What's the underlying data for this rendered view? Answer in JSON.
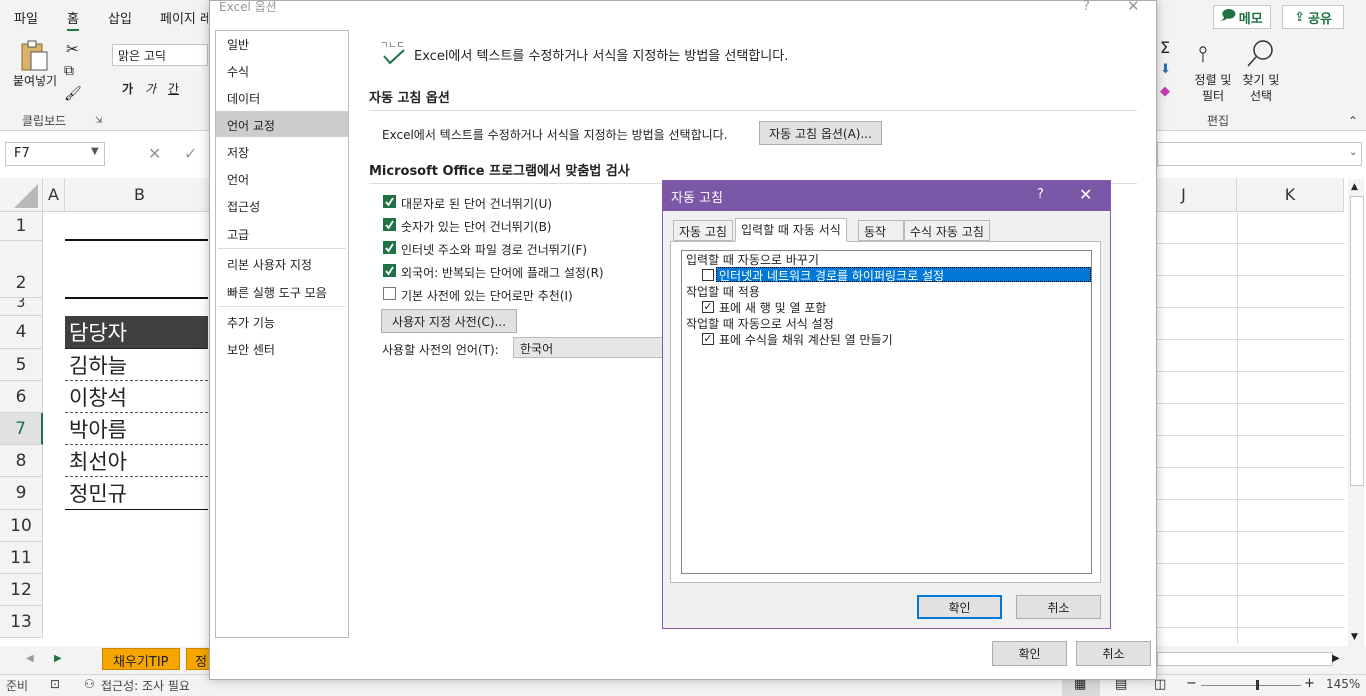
{
  "ribbon": {
    "tabs": [
      "파일",
      "홈",
      "삽입",
      "페이지 레"
    ],
    "active_tab": "홈",
    "memo_label": "메모",
    "share_label": "공유",
    "paste_label": "붙여넣기",
    "clipboard_label": "클립보드",
    "font_name": "맑은 고딕",
    "font_buttons": [
      "가",
      "가",
      "간"
    ],
    "sort_filter_label": "정렬 및\n필터",
    "find_select_label": "찾기 및\n선택",
    "edit_label": "편집"
  },
  "formula_bar": {
    "name_box": "F7"
  },
  "grid": {
    "columns": [
      "A",
      "B",
      "J",
      "K"
    ],
    "rows": [
      "1",
      "2",
      "3",
      "4",
      "5",
      "6",
      "7",
      "8",
      "9",
      "10",
      "11",
      "12",
      "13"
    ],
    "cells": [
      "담당자",
      "김하늘",
      "이창석",
      "박아름",
      "최선아",
      "정민규"
    ]
  },
  "sheet_tabs": [
    "채우기TIP",
    "정"
  ],
  "status_bar": {
    "ready": "준비",
    "accessibility": "접근성: 조사 필요",
    "zoom": "145%"
  },
  "options_dialog": {
    "title": "Excel 옵션",
    "help": "?",
    "nav": [
      "일반",
      "수식",
      "데이터",
      "언어 교정",
      "저장",
      "언어",
      "접근성",
      "고급",
      "리본 사용자 지정",
      "빠른 실행 도구 모음",
      "추가 기능",
      "보안 센터"
    ],
    "selected_nav": "언어 교정",
    "intro": "Excel에서 텍스트를 수정하거나 서식을 지정하는 방법을 선택합니다.",
    "autocorrect_section": "자동 고침 옵션",
    "autocorrect_desc": "Excel에서 텍스트를 수정하거나 서식을 지정하는 방법을 선택합니다.",
    "autocorrect_button": "자동 고침 옵션(A)...",
    "spell_section": "Microsoft Office 프로그램에서 맞춤법 검사",
    "checks": [
      {
        "label": "대문자로 된 단어 건너뛰기(U)",
        "checked": true
      },
      {
        "label": "숫자가 있는 단어 건너뛰기(B)",
        "checked": true
      },
      {
        "label": "인터넷 주소와 파일 경로 건너뛰기(F)",
        "checked": true
      },
      {
        "label": "외국어: 반복되는 단어에 플래그 설정(R)",
        "checked": true
      },
      {
        "label": "기본 사전에 있는 단어로만 추천(I)",
        "checked": false
      }
    ],
    "custom_dict_button": "사용자 지정 사전(C)...",
    "dict_lang_label": "사용할 사전의 언어(T):",
    "dict_lang_value": "한국어",
    "ok": "확인",
    "cancel": "취소"
  },
  "autocorrect_dialog": {
    "title": "자동 고침",
    "help": "?",
    "tabs": [
      "자동 고침",
      "입력할 때 자동 서식",
      "동작",
      "수식 자동 고침"
    ],
    "active_tab": "입력할 때 자동 서식",
    "groups": [
      {
        "heading": "입력할 때 자동으로 바꾸기",
        "items": [
          {
            "label": "인터넷과 네트워크 경로를 하이퍼링크로 설정",
            "checked": false,
            "selected": true
          }
        ]
      },
      {
        "heading": "작업할 때 적용",
        "items": [
          {
            "label": "표에 새 행 및 열 포함",
            "checked": true
          }
        ]
      },
      {
        "heading": "작업할 때 자동으로 서식 설정",
        "items": [
          {
            "label": "표에 수식을 채워 계산된 열 만들기",
            "checked": true
          }
        ]
      }
    ],
    "ok": "확인",
    "cancel": "취소"
  }
}
